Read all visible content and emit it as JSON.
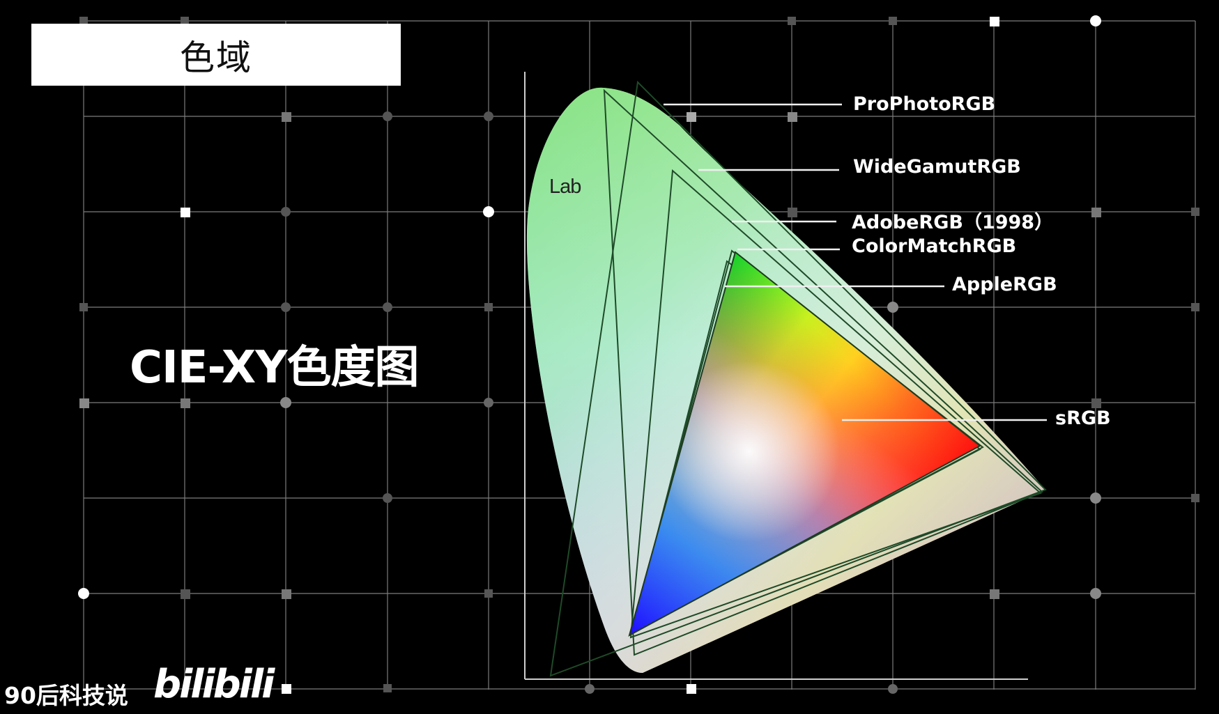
{
  "title": "色域",
  "subtitle": "CIE-XY色度图",
  "diagram": {
    "lab_label": "Lab",
    "gamuts": [
      {
        "name": "ProPhotoRGB"
      },
      {
        "name": "WideGamutRGB"
      },
      {
        "name": "AdobeRGB（1998）"
      },
      {
        "name": "ColorMatchRGB"
      },
      {
        "name": "AppleRGB"
      },
      {
        "name": "sRGB"
      }
    ]
  },
  "watermark": {
    "text": "90后科技说",
    "logo": "bilibili"
  },
  "colors": {
    "background": "#000000",
    "grid": "#8a8a8a",
    "title_box": "#ffffff"
  }
}
